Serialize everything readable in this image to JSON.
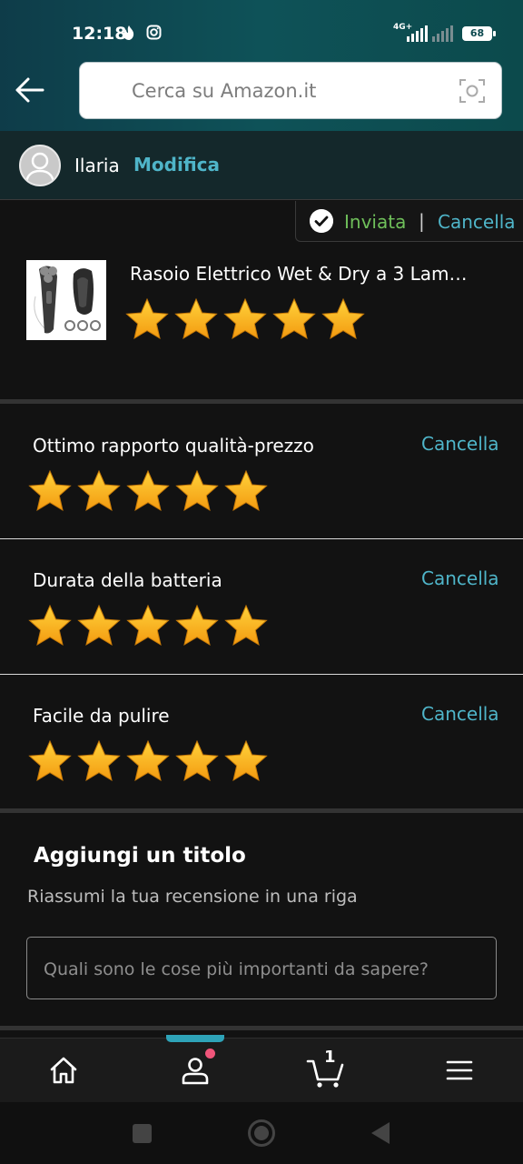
{
  "status_bar": {
    "time": "12:18",
    "network": "4G+",
    "battery": "68"
  },
  "search": {
    "placeholder": "Cerca su Amazon.it"
  },
  "user": {
    "name": "Ilaria",
    "edit_label": "Modifica"
  },
  "review_status": {
    "sent_label": "Inviata",
    "separator": "|",
    "cancel_label": "Cancella"
  },
  "product": {
    "title": "Rasoio Elettrico Wet & Dry a 3 Lam…",
    "rating": 5,
    "max_rating": 5
  },
  "attributes": [
    {
      "label": "Ottimo rapporto qualità-prezzo",
      "cancel_label": "Cancella",
      "rating": 5
    },
    {
      "label": "Durata della batteria",
      "cancel_label": "Cancella",
      "rating": 5
    },
    {
      "label": "Facile da pulire",
      "cancel_label": "Cancella",
      "rating": 5
    }
  ],
  "title_section": {
    "heading": "Aggiungi un titolo",
    "subheading": "Riassumi la tua recensione in una riga",
    "input_placeholder": "Quali sono le cose più importanti da sapere?"
  },
  "bottom_nav": {
    "cart_count": "1",
    "active_tab": "account"
  },
  "colors": {
    "accent": "#4fb5c9",
    "star": "#f5a623",
    "success": "#6fbf5a",
    "notification_dot": "#f0557a"
  }
}
